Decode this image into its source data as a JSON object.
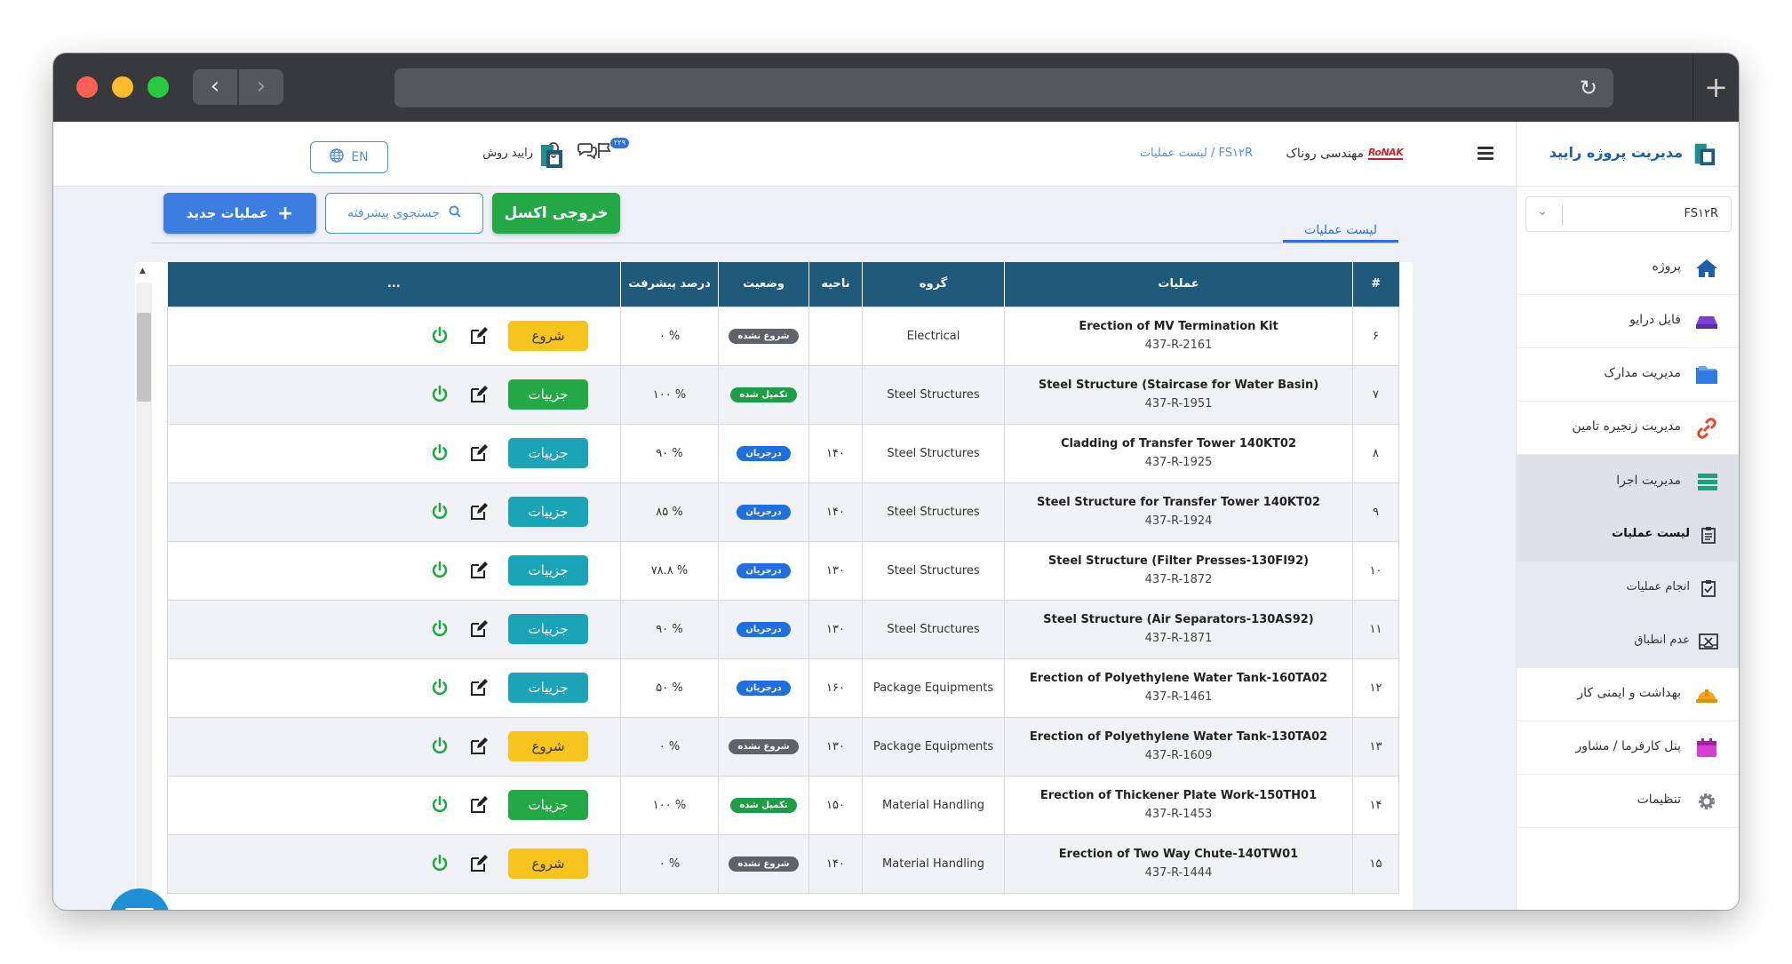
{
  "header": {
    "company_name": "مهندسی روناک",
    "brand_logo_text": "RoNAK",
    "breadcrumb": "FS۱۲R / لیست عملیات",
    "notification_badge": "۲۲۹",
    "user_name": "رایید روش",
    "language_button": "EN"
  },
  "sidebar": {
    "title": "مدیریت پروژه رایید",
    "project_select_value": "FS۱۲R",
    "items": [
      {
        "label": "پروژه"
      },
      {
        "label": "فایل درایو"
      },
      {
        "label": "مدیریت مدارک"
      },
      {
        "label": "مدیریت زنجیره تامین"
      },
      {
        "label": "مدیریت اجرا"
      }
    ],
    "sub_items": [
      {
        "label": "لیست عملیات"
      },
      {
        "label": "انجام عملیات"
      },
      {
        "label": "عدم انطباق"
      }
    ],
    "bottom_items": [
      {
        "label": "بهداشت و ایمنی کار"
      },
      {
        "label": "پنل کارفرما / مشاور"
      },
      {
        "label": "تنظیمات"
      }
    ]
  },
  "content": {
    "tab_label": "لیست عملیات",
    "new_button": "عملیات جدید",
    "search_button": "جستجوی پیشرفته",
    "excel_button": "خروجی اکسل"
  },
  "table": {
    "headers": [
      "#",
      "عملیات",
      "گروه",
      "ناحیه",
      "وضعیت",
      "درصد پیشرفت",
      "..."
    ],
    "rows": [
      {
        "num": "۶",
        "title": "Erection of MV Termination Kit",
        "code": "437-R-2161",
        "group": "Electrical",
        "area": "",
        "status": "شروع نشده",
        "status_type": "notstarted",
        "progress": "% ۰",
        "action": "شروع",
        "action_type": "start"
      },
      {
        "num": "۷",
        "title": "Steel Structure (Staircase for Water Basin)",
        "code": "437-R-1951",
        "group": "Steel Structures",
        "area": "",
        "status": "تکمیل شده",
        "status_type": "done",
        "progress": "% ۱۰۰",
        "action": "جزییات",
        "action_type": "done"
      },
      {
        "num": "۸",
        "title": "Cladding of Transfer Tower 140KT02",
        "code": "437-R-1925",
        "group": "Steel Structures",
        "area": "۱۴۰",
        "status": "درجریان",
        "status_type": "progress",
        "progress": "% ۹۰",
        "action": "جزییات",
        "action_type": "details"
      },
      {
        "num": "۹",
        "title": "Steel Structure for Transfer Tower 140KT02",
        "code": "437-R-1924",
        "group": "Steel Structures",
        "area": "۱۴۰",
        "status": "درجریان",
        "status_type": "progress",
        "progress": "% ۸۵",
        "action": "جزییات",
        "action_type": "details"
      },
      {
        "num": "۱۰",
        "title": "Steel Structure (Filter Presses-130FI92)",
        "code": "437-R-1872",
        "group": "Steel Structures",
        "area": "۱۳۰",
        "status": "درجریان",
        "status_type": "progress",
        "progress": "% ۷۸.۸",
        "action": "جزییات",
        "action_type": "details"
      },
      {
        "num": "۱۱",
        "title": "Steel Structure (Air Separators-130AS92)",
        "code": "437-R-1871",
        "group": "Steel Structures",
        "area": "۱۳۰",
        "status": "درجریان",
        "status_type": "progress",
        "progress": "% ۹۰",
        "action": "جزییات",
        "action_type": "details"
      },
      {
        "num": "۱۲",
        "title": "Erection of Polyethylene Water Tank-160TA02",
        "code": "437-R-1461",
        "group": "Package Equipments",
        "area": "۱۶۰",
        "status": "درجریان",
        "status_type": "progress",
        "progress": "% ۵۰",
        "action": "جزییات",
        "action_type": "details"
      },
      {
        "num": "۱۳",
        "title": "Erection of Polyethylene Water Tank-130TA02",
        "code": "437-R-1609",
        "group": "Package Equipments",
        "area": "۱۳۰",
        "status": "شروع نشده",
        "status_type": "notstarted",
        "progress": "% ۰",
        "action": "شروع",
        "action_type": "start"
      },
      {
        "num": "۱۴",
        "title": "Erection of Thickener Plate Work-150TH01",
        "code": "437-R-1453",
        "group": "Material Handling",
        "area": "۱۵۰",
        "status": "تکمیل شده",
        "status_type": "done",
        "progress": "% ۱۰۰",
        "action": "جزییات",
        "action_type": "done"
      },
      {
        "num": "۱۵",
        "title": "Erection of Two Way Chute-140TW01",
        "code": "437-R-1444",
        "group": "Material Handling",
        "area": "۱۴۰",
        "status": "شروع نشده",
        "status_type": "notstarted",
        "progress": "% ۰",
        "action": "شروع",
        "action_type": "start"
      }
    ]
  },
  "colors": {
    "primary": "#3b7ee0",
    "header_bg": "#1f5a7a",
    "success": "#24a745",
    "warning": "#f7c41b",
    "info": "#1ba3b8"
  }
}
